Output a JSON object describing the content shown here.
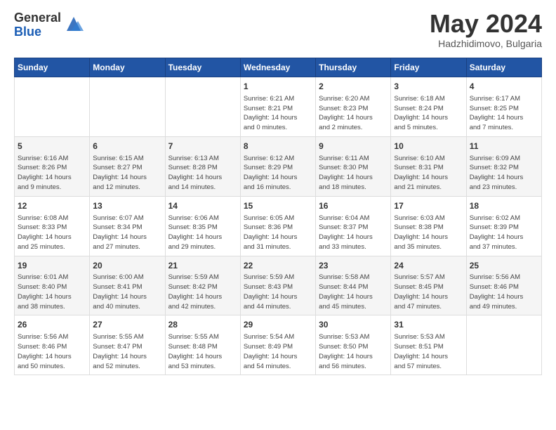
{
  "header": {
    "logo_general": "General",
    "logo_blue": "Blue",
    "month_year": "May 2024",
    "location": "Hadzhidimovo, Bulgaria"
  },
  "weekdays": [
    "Sunday",
    "Monday",
    "Tuesday",
    "Wednesday",
    "Thursday",
    "Friday",
    "Saturday"
  ],
  "weeks": [
    [
      {
        "day": "",
        "info": ""
      },
      {
        "day": "",
        "info": ""
      },
      {
        "day": "",
        "info": ""
      },
      {
        "day": "1",
        "info": "Sunrise: 6:21 AM\nSunset: 8:21 PM\nDaylight: 14 hours\nand 0 minutes."
      },
      {
        "day": "2",
        "info": "Sunrise: 6:20 AM\nSunset: 8:23 PM\nDaylight: 14 hours\nand 2 minutes."
      },
      {
        "day": "3",
        "info": "Sunrise: 6:18 AM\nSunset: 8:24 PM\nDaylight: 14 hours\nand 5 minutes."
      },
      {
        "day": "4",
        "info": "Sunrise: 6:17 AM\nSunset: 8:25 PM\nDaylight: 14 hours\nand 7 minutes."
      }
    ],
    [
      {
        "day": "5",
        "info": "Sunrise: 6:16 AM\nSunset: 8:26 PM\nDaylight: 14 hours\nand 9 minutes."
      },
      {
        "day": "6",
        "info": "Sunrise: 6:15 AM\nSunset: 8:27 PM\nDaylight: 14 hours\nand 12 minutes."
      },
      {
        "day": "7",
        "info": "Sunrise: 6:13 AM\nSunset: 8:28 PM\nDaylight: 14 hours\nand 14 minutes."
      },
      {
        "day": "8",
        "info": "Sunrise: 6:12 AM\nSunset: 8:29 PM\nDaylight: 14 hours\nand 16 minutes."
      },
      {
        "day": "9",
        "info": "Sunrise: 6:11 AM\nSunset: 8:30 PM\nDaylight: 14 hours\nand 18 minutes."
      },
      {
        "day": "10",
        "info": "Sunrise: 6:10 AM\nSunset: 8:31 PM\nDaylight: 14 hours\nand 21 minutes."
      },
      {
        "day": "11",
        "info": "Sunrise: 6:09 AM\nSunset: 8:32 PM\nDaylight: 14 hours\nand 23 minutes."
      }
    ],
    [
      {
        "day": "12",
        "info": "Sunrise: 6:08 AM\nSunset: 8:33 PM\nDaylight: 14 hours\nand 25 minutes."
      },
      {
        "day": "13",
        "info": "Sunrise: 6:07 AM\nSunset: 8:34 PM\nDaylight: 14 hours\nand 27 minutes."
      },
      {
        "day": "14",
        "info": "Sunrise: 6:06 AM\nSunset: 8:35 PM\nDaylight: 14 hours\nand 29 minutes."
      },
      {
        "day": "15",
        "info": "Sunrise: 6:05 AM\nSunset: 8:36 PM\nDaylight: 14 hours\nand 31 minutes."
      },
      {
        "day": "16",
        "info": "Sunrise: 6:04 AM\nSunset: 8:37 PM\nDaylight: 14 hours\nand 33 minutes."
      },
      {
        "day": "17",
        "info": "Sunrise: 6:03 AM\nSunset: 8:38 PM\nDaylight: 14 hours\nand 35 minutes."
      },
      {
        "day": "18",
        "info": "Sunrise: 6:02 AM\nSunset: 8:39 PM\nDaylight: 14 hours\nand 37 minutes."
      }
    ],
    [
      {
        "day": "19",
        "info": "Sunrise: 6:01 AM\nSunset: 8:40 PM\nDaylight: 14 hours\nand 38 minutes."
      },
      {
        "day": "20",
        "info": "Sunrise: 6:00 AM\nSunset: 8:41 PM\nDaylight: 14 hours\nand 40 minutes."
      },
      {
        "day": "21",
        "info": "Sunrise: 5:59 AM\nSunset: 8:42 PM\nDaylight: 14 hours\nand 42 minutes."
      },
      {
        "day": "22",
        "info": "Sunrise: 5:59 AM\nSunset: 8:43 PM\nDaylight: 14 hours\nand 44 minutes."
      },
      {
        "day": "23",
        "info": "Sunrise: 5:58 AM\nSunset: 8:44 PM\nDaylight: 14 hours\nand 45 minutes."
      },
      {
        "day": "24",
        "info": "Sunrise: 5:57 AM\nSunset: 8:45 PM\nDaylight: 14 hours\nand 47 minutes."
      },
      {
        "day": "25",
        "info": "Sunrise: 5:56 AM\nSunset: 8:46 PM\nDaylight: 14 hours\nand 49 minutes."
      }
    ],
    [
      {
        "day": "26",
        "info": "Sunrise: 5:56 AM\nSunset: 8:46 PM\nDaylight: 14 hours\nand 50 minutes."
      },
      {
        "day": "27",
        "info": "Sunrise: 5:55 AM\nSunset: 8:47 PM\nDaylight: 14 hours\nand 52 minutes."
      },
      {
        "day": "28",
        "info": "Sunrise: 5:55 AM\nSunset: 8:48 PM\nDaylight: 14 hours\nand 53 minutes."
      },
      {
        "day": "29",
        "info": "Sunrise: 5:54 AM\nSunset: 8:49 PM\nDaylight: 14 hours\nand 54 minutes."
      },
      {
        "day": "30",
        "info": "Sunrise: 5:53 AM\nSunset: 8:50 PM\nDaylight: 14 hours\nand 56 minutes."
      },
      {
        "day": "31",
        "info": "Sunrise: 5:53 AM\nSunset: 8:51 PM\nDaylight: 14 hours\nand 57 minutes."
      },
      {
        "day": "",
        "info": ""
      }
    ]
  ]
}
